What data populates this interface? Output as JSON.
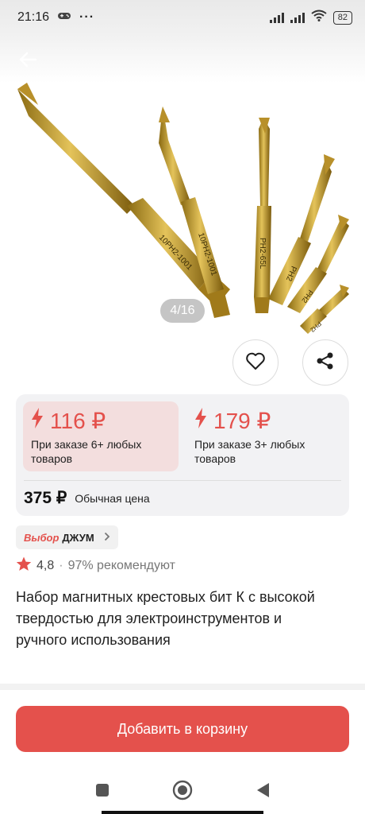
{
  "status_bar": {
    "time": "21:16",
    "dots": "···",
    "battery": "82"
  },
  "image": {
    "counter": "4/16",
    "bit_labels": [
      "10PH2-1001",
      "10PH2-1001",
      "PH2-65L",
      "PH2",
      "PH2",
      "PH2"
    ]
  },
  "pricing": {
    "options": [
      {
        "price": "116 ₽",
        "condition": "При заказе 6+ любых товаров"
      },
      {
        "price": "179 ₽",
        "condition": "При заказе 3+ любых товаров"
      }
    ],
    "regular_price": "375 ₽",
    "regular_label": "Обычная цена"
  },
  "badge": {
    "brand": "Выбор",
    "name": "ДЖУМ"
  },
  "rating": {
    "value": "4,8",
    "separator": "·",
    "recommend": "97% рекомендуют"
  },
  "product": {
    "title": "Набор магнитных крестовых бит К с высокой твердостью для электроинструментов и ручного использования"
  },
  "actions": {
    "add_to_cart": "Добавить в корзину"
  },
  "colors": {
    "accent": "#e4514c",
    "selected_bg": "#f3dede",
    "card_bg": "#f2f2f4",
    "bit_gold": "#c9a227"
  },
  "icons": [
    "arrow-left-icon",
    "heart-icon",
    "share-icon",
    "lightning-icon",
    "star-icon",
    "chevron-right-icon"
  ]
}
